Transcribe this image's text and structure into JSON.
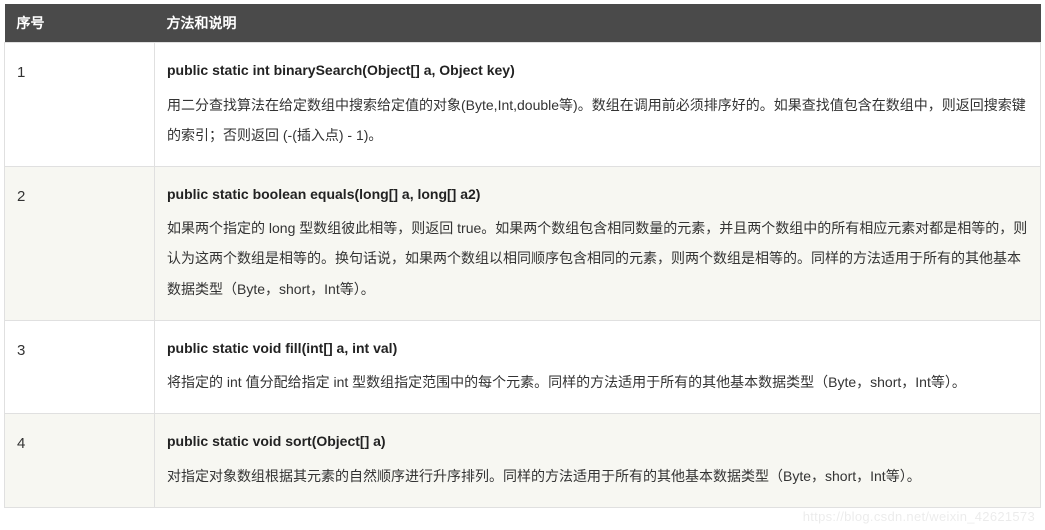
{
  "table": {
    "headers": {
      "index": "序号",
      "method": "方法和说明"
    },
    "rows": [
      {
        "index": "1",
        "signature": "public static int binarySearch(Object[] a, Object key)",
        "description": "用二分查找算法在给定数组中搜索给定值的对象(Byte,Int,double等)。数组在调用前必须排序好的。如果查找值包含在数组中，则返回搜索键的索引；否则返回 (-(插入点) - 1)。"
      },
      {
        "index": "2",
        "signature": "public static boolean equals(long[] a, long[] a2)",
        "description": "如果两个指定的 long 型数组彼此相等，则返回 true。如果两个数组包含相同数量的元素，并且两个数组中的所有相应元素对都是相等的，则认为这两个数组是相等的。换句话说，如果两个数组以相同顺序包含相同的元素，则两个数组是相等的。同样的方法适用于所有的其他基本数据类型（Byte，short，Int等）。"
      },
      {
        "index": "3",
        "signature": "public static void fill(int[] a, int val)",
        "description": "将指定的 int 值分配给指定 int 型数组指定范围中的每个元素。同样的方法适用于所有的其他基本数据类型（Byte，short，Int等）。"
      },
      {
        "index": "4",
        "signature": "public static void sort(Object[] a)",
        "description": "对指定对象数组根据其元素的自然顺序进行升序排列。同样的方法适用于所有的其他基本数据类型（Byte，short，Int等）。"
      }
    ]
  },
  "watermark": "https://blog.csdn.net/weixin_42621573"
}
